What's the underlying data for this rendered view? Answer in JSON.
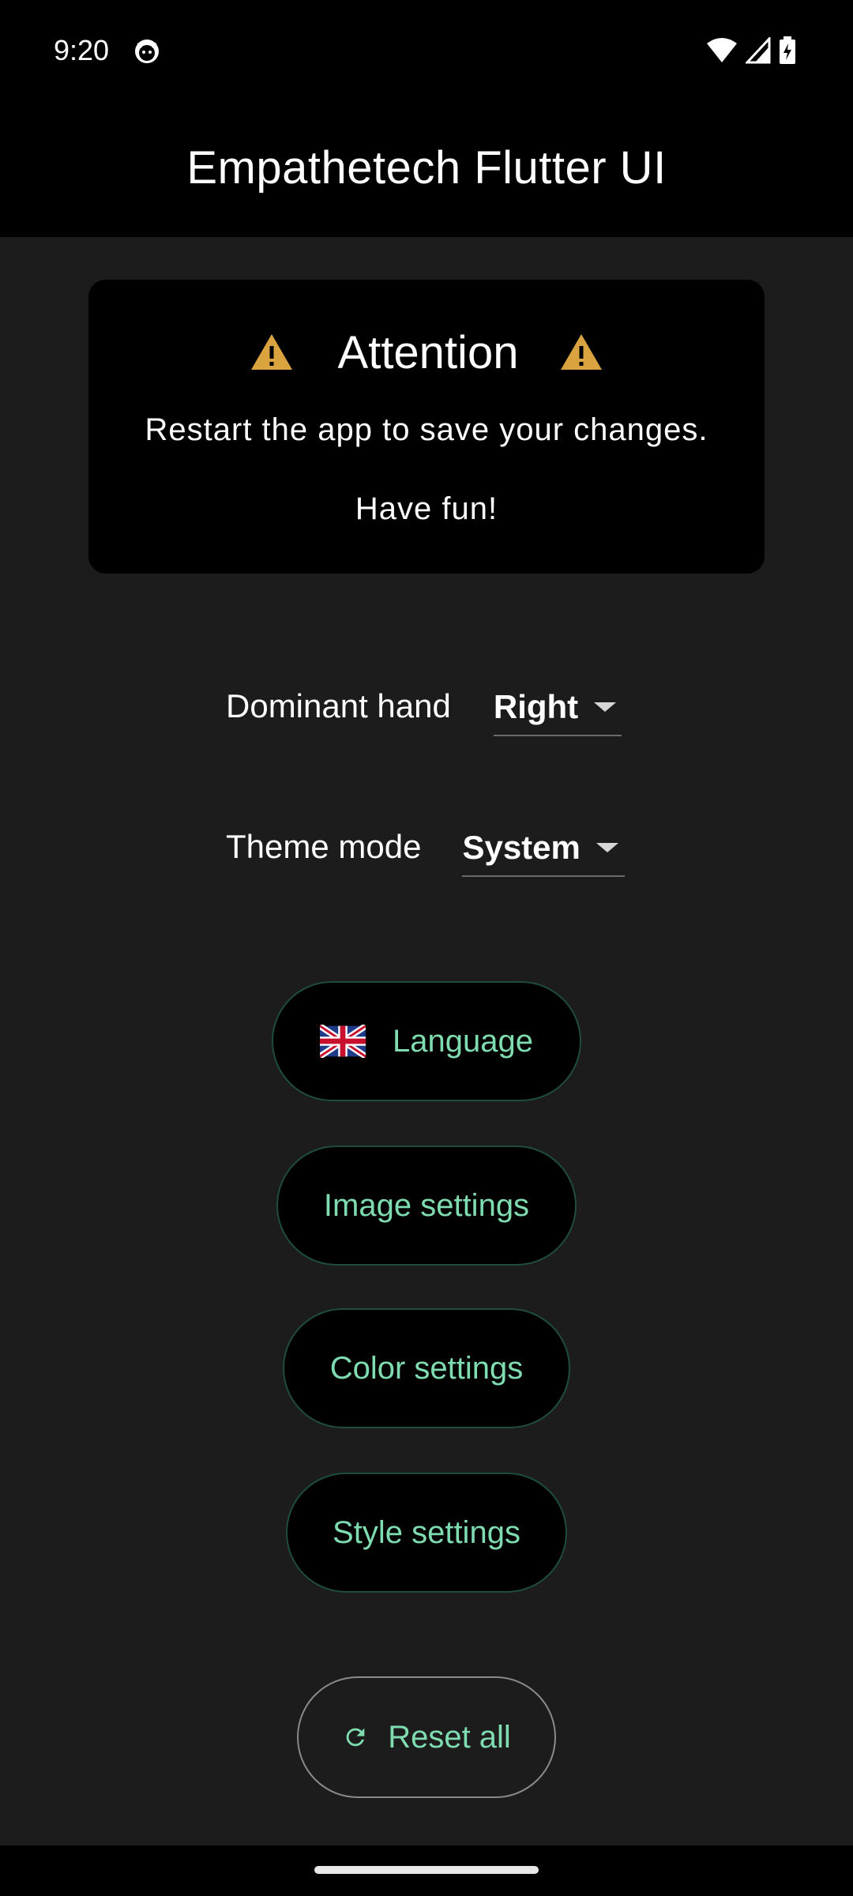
{
  "status_bar": {
    "time": "9:20",
    "app_icon": "cat-face-icon",
    "icons": [
      "wifi-icon",
      "cell-signal-icon",
      "battery-charging-icon"
    ]
  },
  "app_bar": {
    "title": "Empathetech Flutter UI"
  },
  "attention": {
    "icon": "warning-icon",
    "icon_color": "#d9a440",
    "title": "Attention",
    "message": "Restart the app to save your changes.",
    "subtitle": "Have fun!"
  },
  "settings": {
    "dominant_hand": {
      "label": "Dominant hand",
      "value": "Right"
    },
    "theme_mode": {
      "label": "Theme mode",
      "value": "System"
    }
  },
  "buttons": {
    "language": "Language",
    "language_icon": "uk-flag-icon",
    "image_settings": "Image settings",
    "color_settings": "Color settings",
    "style_settings": "Style settings",
    "reset_all": "Reset all",
    "reset_icon": "refresh-icon"
  },
  "colors": {
    "accent": "#7edcb0",
    "background": "#1c1c1c",
    "surface": "#000000"
  }
}
